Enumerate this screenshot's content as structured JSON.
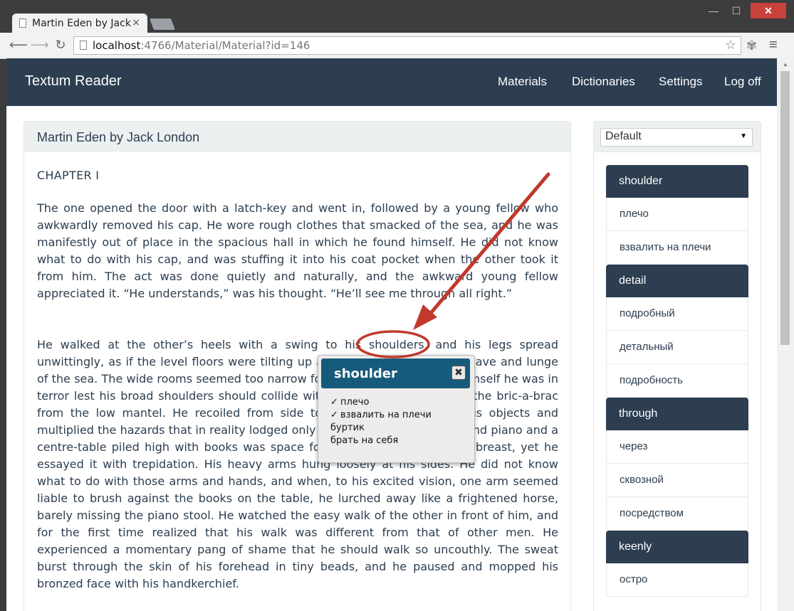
{
  "browser": {
    "tab_title": "Martin Eden by Jack",
    "tab_close": "×",
    "url_host": "localhost",
    "url_path": ":4766/Material/Material?id=146",
    "minimize": "—",
    "maximize": "☐",
    "close": "✕"
  },
  "navbar": {
    "brand": "Textum Reader",
    "links": [
      "Materials",
      "Dictionaries",
      "Settings",
      "Log off"
    ]
  },
  "material": {
    "title": "Martin Eden by Jack London",
    "chapter": "CHAPTER I",
    "paragraph1": "The one opened the door with a latch-key and went in, followed by a young fellow who awkwardly removed his cap. He wore rough clothes that smacked of the sea, and he was manifestly out of place in the spacious hall in which he found himself. He did not know what to do with his cap, and was stuffing it into his coat pocket when the other took it from him. The act was done quietly and naturally, and the awkward young fellow appreciated it. “He understands,” was his thought. “He’ll see me through all right.”",
    "paragraph2": "He walked at the other’s heels with a swing to his shoulders, and his legs spread unwittingly, as if the level floors were tilting up and sinking down to the heave and lunge of the sea. The wide rooms seemed too narrow for his rolling gait, and to himself he was in terror lest his broad shoulders should collide with the doorways or sweep the bric-a-brac from the low mantel. He recoiled from side to side between the various objects and multiplied the hazards that in reality lodged only in his mind. Between a grand piano and a centre-table piled high with books was space for a half a dozen to walk abreast, yet he essayed it with trepidation. His heavy arms hung loosely at his sides. He did not know what to do with those arms and hands, and when, to his excited vision, one arm seemed liable to brush against the books on the table, he lurched away like a frightened horse, barely missing the piano stool. He watched the easy walk of the other in front of him, and for the first time realized that his walk was different from that of other men. He experienced a momentary pang of shame that he should walk so uncouthly. The sweat burst through the skin of his forehead in tiny beads, and he paused and mopped his bronzed face with his handkerchief."
  },
  "sidebar": {
    "dictionary_select": "Default",
    "entries": [
      {
        "word": "shoulder",
        "translations": [
          "плечо",
          "взвалить на плечи"
        ]
      },
      {
        "word": "detail",
        "translations": [
          "подробный",
          "детальный",
          "подробность"
        ]
      },
      {
        "word": "through",
        "translations": [
          "через",
          "сквозной",
          "посредством"
        ]
      },
      {
        "word": "keenly",
        "translations": [
          "остро"
        ]
      }
    ]
  },
  "popup": {
    "word": "shoulder",
    "close": "✖",
    "options": [
      {
        "text": "плечо",
        "mark": "✓"
      },
      {
        "text": "взвалить на плечи",
        "mark": "✓"
      },
      {
        "text": "буртик",
        "mark": ""
      },
      {
        "text": "брать на себя",
        "mark": ""
      }
    ]
  },
  "colors": {
    "navbar": "#2c3e50",
    "popup_header": "#175b7c",
    "annotation": "#c0392b"
  }
}
